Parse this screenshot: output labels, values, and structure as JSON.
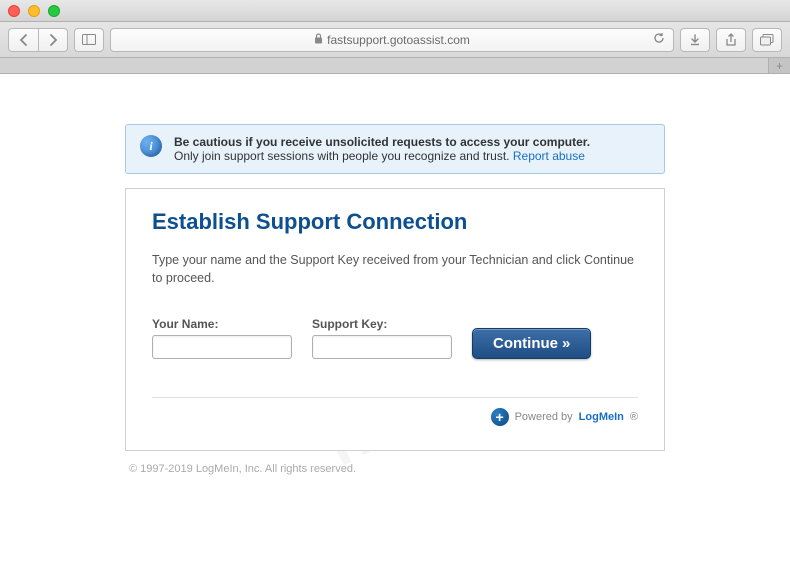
{
  "browser": {
    "url": "fastsupport.gotoassist.com"
  },
  "alert": {
    "bold": "Be cautious if you receive unsolicited requests to access your computer.",
    "text": "Only join support sessions with people you recognize and trust. ",
    "link": "Report abuse"
  },
  "card": {
    "title": "Establish Support Connection",
    "desc": "Type your name and the Support Key received from your Technician and click Continue to proceed.",
    "name_label": "Your Name:",
    "key_label": "Support Key:",
    "continue": "Continue",
    "powered_by": "Powered by",
    "brand": "LogMeIn",
    "reg": "®"
  },
  "footer": {
    "copyright": "© 1997-2019 LogMeIn, Inc. All rights reserved."
  }
}
